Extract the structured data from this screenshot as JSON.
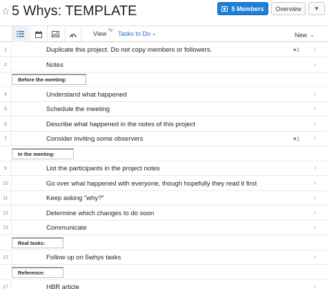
{
  "header": {
    "title": "5 Whys: TEMPLATE",
    "members_label": "5 Members",
    "overview_label": "Overview"
  },
  "toolbar": {
    "view_label": "View",
    "view_value": "Tasks to Do",
    "new_label": "New"
  },
  "rows": [
    {
      "type": "task",
      "num": "1",
      "text": "Duplicate this project. Do not copy members or followers.",
      "hearts": "1"
    },
    {
      "type": "task",
      "num": "2",
      "text": "Notes",
      "hearts": ""
    },
    {
      "type": "section",
      "num": "",
      "text": "Before the meeting:",
      "hearts": ""
    },
    {
      "type": "task",
      "num": "4",
      "text": "Understand what happened",
      "hearts": ""
    },
    {
      "type": "task",
      "num": "5",
      "text": "Schedule the meeting",
      "hearts": ""
    },
    {
      "type": "task",
      "num": "6",
      "text": "Describe what happened in the notes of this project",
      "hearts": ""
    },
    {
      "type": "task",
      "num": "7",
      "text": "Consider inviting some observers",
      "hearts": "1"
    },
    {
      "type": "section",
      "num": "",
      "text": "In the meeting:",
      "hearts": ""
    },
    {
      "type": "task",
      "num": "9",
      "text": "List the participants in the project notes",
      "hearts": ""
    },
    {
      "type": "task",
      "num": "10",
      "text": "Go over what happened with everyone, though hopefully they read it first",
      "hearts": ""
    },
    {
      "type": "task",
      "num": "11",
      "text": "Keep asking \"why?\"",
      "hearts": ""
    },
    {
      "type": "task",
      "num": "12",
      "text": "Determine which changes to do soon",
      "hearts": ""
    },
    {
      "type": "task",
      "num": "13",
      "text": "Communicate",
      "hearts": ""
    },
    {
      "type": "section",
      "num": "",
      "text": "Real tasks:",
      "hearts": ""
    },
    {
      "type": "task",
      "num": "15",
      "text": "Follow up on 5whys tasks",
      "hearts": ""
    },
    {
      "type": "section",
      "num": "",
      "text": "Reference:",
      "hearts": ""
    },
    {
      "type": "task",
      "num": "17",
      "text": "HBR article",
      "hearts": ""
    }
  ]
}
